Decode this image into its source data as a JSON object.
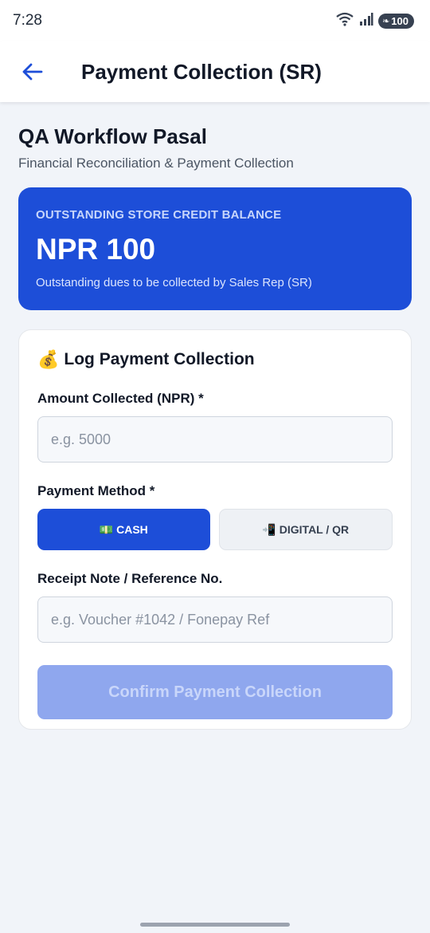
{
  "status_bar": {
    "time": "7:28",
    "battery": "100"
  },
  "app_bar": {
    "title": "Payment Collection (SR)"
  },
  "store": {
    "name": "QA Workflow Pasal",
    "subtitle": "Financial Reconciliation & Payment Collection"
  },
  "balance": {
    "label": "OUTSTANDING STORE CREDIT BALANCE",
    "amount": "NPR 100",
    "note": "Outstanding dues to be collected by Sales Rep (SR)"
  },
  "form": {
    "title_icon": "💰",
    "title": "Log Payment Collection",
    "amount_label": "Amount Collected (NPR) *",
    "amount_placeholder": "e.g. 5000",
    "method_label": "Payment Method *",
    "methods": [
      {
        "icon": "💵",
        "label": "CASH",
        "selected": true
      },
      {
        "icon": "📲",
        "label": "DIGITAL / QR",
        "selected": false
      }
    ],
    "note_label": "Receipt Note / Reference No.",
    "note_placeholder": "e.g. Voucher #1042 / Fonepay Ref",
    "confirm_label": "Confirm Payment Collection"
  },
  "colors": {
    "primary": "#1d4ed8",
    "disabled": "#8fa7ee",
    "background": "#f1f4f9"
  }
}
